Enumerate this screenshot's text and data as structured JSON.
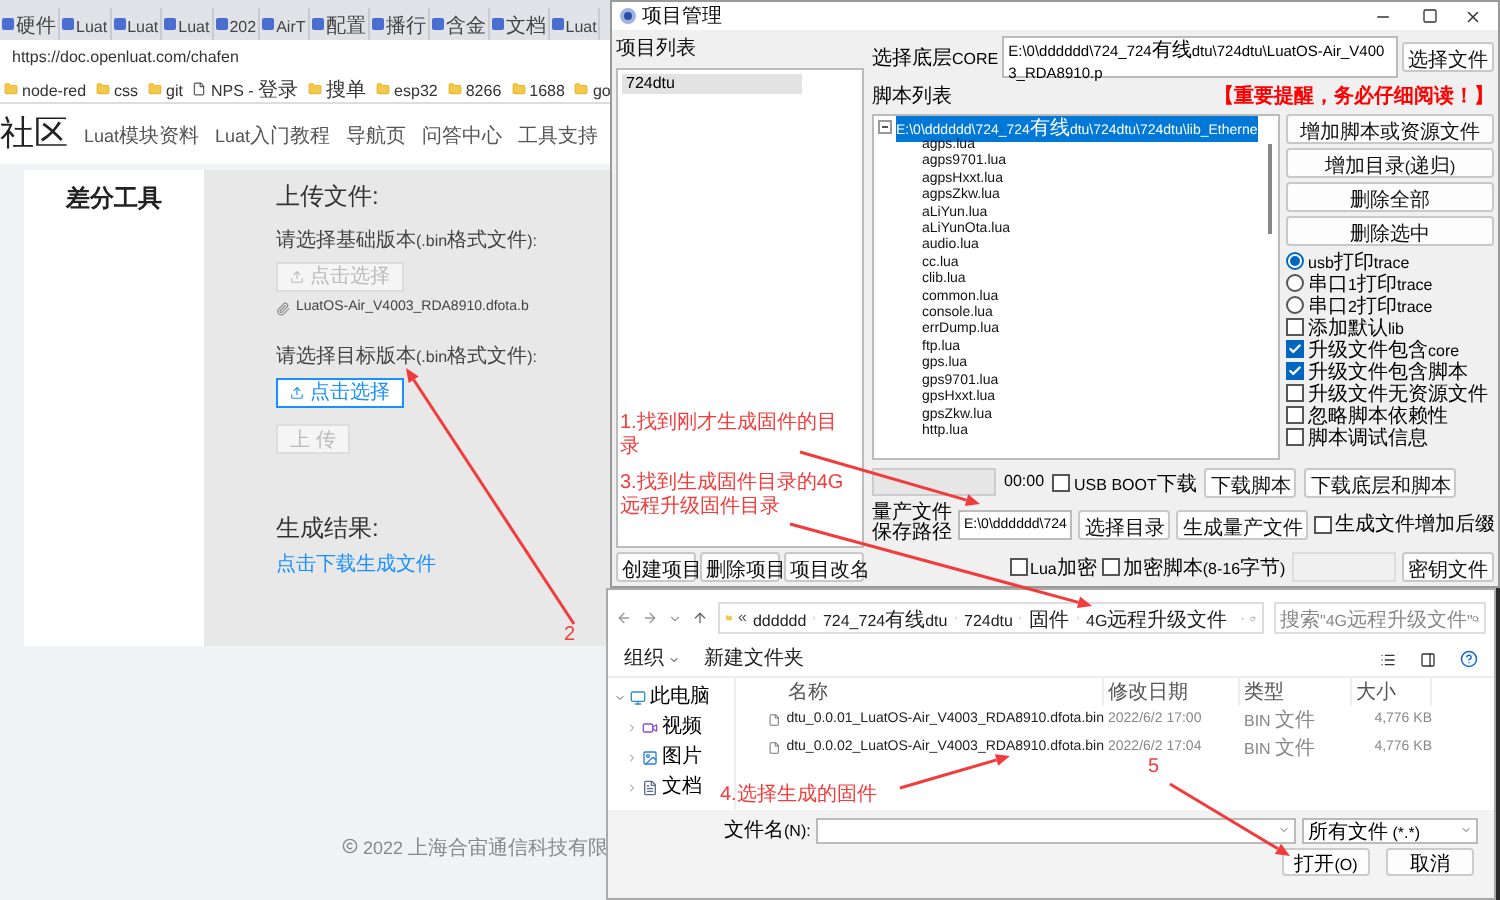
{
  "browser": {
    "tabs": [
      {
        "label": "硬件"
      },
      {
        "label": "Luat"
      },
      {
        "label": "Luat"
      },
      {
        "label": "Luat"
      },
      {
        "label": "202"
      },
      {
        "label": "AirT"
      },
      {
        "label": "配置"
      },
      {
        "label": "播行"
      },
      {
        "label": "含金"
      },
      {
        "label": "文档"
      },
      {
        "label": "Luat"
      }
    ],
    "url": "https://doc.openluat.com/chafen",
    "bookmarks": [
      {
        "label": "node-red",
        "kind": "folder"
      },
      {
        "label": "css",
        "kind": "folder"
      },
      {
        "label": "git",
        "kind": "folder"
      },
      {
        "label": "NPS - 登录",
        "kind": "page"
      },
      {
        "label": "搜单",
        "kind": "folder"
      },
      {
        "label": "esp32",
        "kind": "folder"
      },
      {
        "label": "8266",
        "kind": "folder"
      },
      {
        "label": "1688",
        "kind": "folder"
      },
      {
        "label": "go",
        "kind": "folder"
      }
    ]
  },
  "site": {
    "logo": "社区",
    "nav": [
      "Luat模块资料",
      "Luat入门教程",
      "导航页",
      "问答中心",
      "工具支持"
    ],
    "sidebar_title": "差分工具",
    "upload_heading": "上传文件:",
    "base_label": "请选择基础版本(.bin格式文件):",
    "base_button": {
      "label": "点击选择",
      "disabled": true
    },
    "base_file": "LuatOS-Air_V4003_RDA8910.dfota.b",
    "target_label": "请选择目标版本(.bin格式文件):",
    "target_button": {
      "label": "点击选择",
      "disabled": false
    },
    "upload_button": {
      "label": "上 传",
      "disabled": true
    },
    "result_heading": "生成结果:",
    "download_link": "点击下载生成文件",
    "footer": "2022 上海合宙通信科技有限"
  },
  "project_window": {
    "title": "项目管理",
    "project_list_label": "项目列表",
    "projects": [
      {
        "name": "724dtu",
        "selected": true
      }
    ],
    "core_label": "选择底层CORE",
    "core_path": "E:\\0\\dddddd\\724_724有线dtu\\724dtu\\LuatOS-Air_V4003_RDA8910.p",
    "core_button": "选择文件",
    "script_label": "脚本列表",
    "warning": "【重要提醒，务必仔细阅读！】",
    "tree": {
      "label": "E:\\0\\dddddd\\724_724有线dtu\\724dtu\\724dtu\\lib_Etherne",
      "expanded": true,
      "selected": true,
      "children": [
        {
          "label": "agps.lua"
        },
        {
          "label": "agps9701.lua"
        },
        {
          "label": "agpsHxxt.lua"
        },
        {
          "label": "agpsZkw.lua"
        },
        {
          "label": "aLiYun.lua"
        },
        {
          "label": "aLiYunOta.lua"
        },
        {
          "label": "audio.lua"
        },
        {
          "label": "cc.lua"
        },
        {
          "label": "clib.lua"
        },
        {
          "label": "common.lua"
        },
        {
          "label": "console.lua"
        },
        {
          "label": "errDump.lua"
        },
        {
          "label": "ftp.lua"
        },
        {
          "label": "gps.lua"
        },
        {
          "label": "gps9701.lua"
        },
        {
          "label": "gpsHxxt.lua"
        },
        {
          "label": "gpsZkw.lua"
        },
        {
          "label": "http.lua"
        }
      ]
    },
    "side_buttons": [
      "增加脚本或资源文件",
      "增加目录(递归)",
      "删除全部",
      "删除选中"
    ],
    "options": [
      {
        "kind": "radio",
        "label": "usb打印trace",
        "checked": true
      },
      {
        "kind": "radio",
        "label": "串口1打印trace",
        "checked": false
      },
      {
        "kind": "radio",
        "label": "串口2打印trace",
        "checked": false
      },
      {
        "kind": "checkbox",
        "label": "添加默认lib",
        "checked": false
      },
      {
        "kind": "checkbox",
        "label": "升级文件包含core",
        "checked": true
      },
      {
        "kind": "checkbox",
        "label": "升级文件包含脚本",
        "checked": true
      },
      {
        "kind": "checkbox",
        "label": "升级文件无资源文件",
        "checked": false
      },
      {
        "kind": "checkbox",
        "label": "忽略脚本依赖性",
        "checked": false
      },
      {
        "kind": "checkbox",
        "label": "脚本调试信息",
        "checked": false
      }
    ],
    "progress": {
      "level": 0
    },
    "timer": "00:00",
    "usb_boot": {
      "label": "USB BOOT下载",
      "checked": false
    },
    "download_buttons": [
      "下载脚本",
      "下载底层和脚本"
    ],
    "save_path_label": "量产文件保存路径",
    "save_path": "E:\\0\\dddddd\\724",
    "choose_dir_button": "选择目录",
    "generate_button": "生成量产文件",
    "suffix_option": {
      "label": "生成文件增加后缀",
      "checked": false
    },
    "project_buttons": [
      "创建项目",
      "删除项目",
      "项目改名"
    ],
    "lua_encrypt": {
      "label": "Lua加密",
      "checked": false
    },
    "script_encrypt": {
      "label": "加密脚本(8-16字节)",
      "checked": false
    },
    "key_button": "密钥文件"
  },
  "file_dialog": {
    "overflow_marker": "«",
    "breadcrumb": [
      "dddddd",
      "724_724有线dtu",
      "724dtu",
      "固件",
      "4G远程升级文件"
    ],
    "search_placeholder": "搜索\"4G远程升级文件\"",
    "organize": "组织",
    "new_folder": "新建文件夹",
    "nav": {
      "label": "此电脑",
      "expanded": true,
      "children": [
        {
          "label": "视频",
          "kind": "video"
        },
        {
          "label": "图片",
          "kind": "picture"
        },
        {
          "label": "文档",
          "kind": "document"
        }
      ]
    },
    "columns": [
      "名称",
      "修改日期",
      "类型",
      "大小"
    ],
    "files": [
      {
        "name": "dtu_0.0.01_LuatOS-Air_V4003_RDA8910.dfota.bin",
        "modified": "2022/6/2 17:00",
        "type": "BIN 文件",
        "size": "4,776 KB"
      },
      {
        "name": "dtu_0.0.02_LuatOS-Air_V4003_RDA8910.dfota.bin",
        "modified": "2022/6/2 17:04",
        "type": "BIN 文件",
        "size": "4,776 KB"
      }
    ],
    "filename_label": "文件名(N):",
    "filter": "所有文件 (*.*)",
    "open_button": "打开(O)",
    "cancel_button": "取消"
  },
  "annotations": [
    {
      "text": "1.找到刚才生成固件的目录"
    },
    {
      "text": "2"
    },
    {
      "text": "3.找到生成固件目录的4G远程升级固件目录"
    },
    {
      "text": "4.选择生成的固件"
    },
    {
      "text": "5"
    }
  ]
}
